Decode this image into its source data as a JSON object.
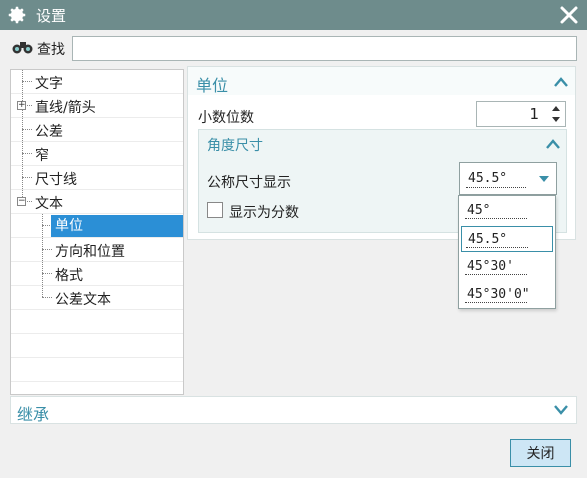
{
  "window": {
    "title": "设置",
    "gear_icon": "gear-icon",
    "close_icon": "close-icon"
  },
  "find": {
    "label": "查找",
    "icon": "binoculars-icon",
    "value": ""
  },
  "tree": [
    {
      "label": "文字"
    },
    {
      "label": "直线/箭头",
      "expander": "+"
    },
    {
      "label": "公差"
    },
    {
      "label": "窄"
    },
    {
      "label": "尺寸线"
    },
    {
      "label": "文本",
      "expander": "−"
    },
    {
      "label": "单位",
      "selected": true
    },
    {
      "label": "方向和位置"
    },
    {
      "label": "格式"
    },
    {
      "label": "公差文本"
    }
  ],
  "units": {
    "title": "单位",
    "decimal_label": "小数位数",
    "decimal_value": "1",
    "angle": {
      "title": "角度尺寸",
      "nominal_label": "公称尺寸显示",
      "nominal_value": "45.5°",
      "fraction_label": "显示为分数",
      "fraction_checked": false,
      "options": [
        "45°",
        "45.5°",
        "45°30'",
        "45°30'0\""
      ],
      "highlighted_option": 1
    }
  },
  "inherit": {
    "title": "继承"
  },
  "buttons": {
    "close": "关闭"
  },
  "colors": {
    "titlebar": "#6e8c8c",
    "accent": "#3a8fa8",
    "selection": "#2b8fd6",
    "close_button": "#cde6f5"
  }
}
